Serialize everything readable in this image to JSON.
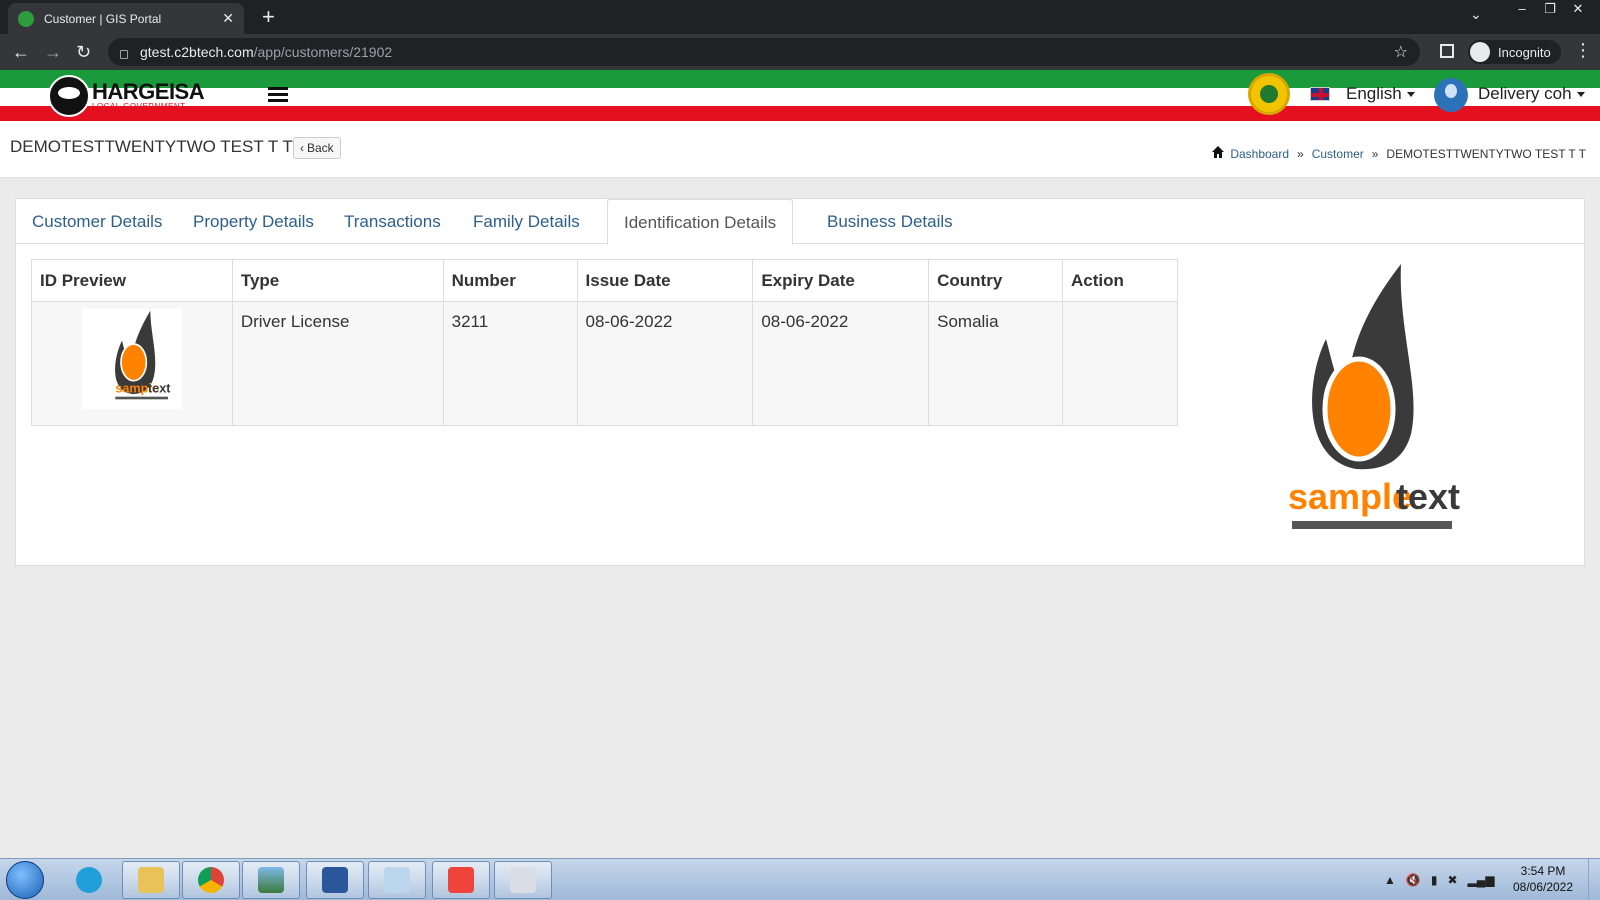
{
  "browser": {
    "tab_title": "Customer | GIS Portal",
    "tab_close": "✕",
    "new_tab": "+",
    "url_host": "gtest.c2btech.com",
    "url_path": "/app/customers/21902",
    "incognito_label": "Incognito"
  },
  "header": {
    "logo_name": "HARGEISA",
    "logo_sub": "LOCAL GOVERNMENT",
    "language": "English",
    "user_name": "Delivery coh"
  },
  "page": {
    "title": "DEMOTESTTWENTYTWO TEST T T",
    "back_label": "Back",
    "breadcrumb": [
      "Dashboard",
      "Customer",
      "DEMOTESTTWENTYTWO TEST T T"
    ],
    "breadcrumb_sep": "»"
  },
  "tabs": [
    {
      "label": "Customer Details",
      "active": false
    },
    {
      "label": "Property Details",
      "active": false
    },
    {
      "label": "Transactions",
      "active": false
    },
    {
      "label": "Family Details",
      "active": false
    },
    {
      "label": "Identification Details",
      "active": true
    },
    {
      "label": "Business Details",
      "active": false
    }
  ],
  "id_table": {
    "columns": [
      "ID Preview",
      "Type",
      "Number",
      "Issue Date",
      "Expiry Date",
      "Country",
      "Action"
    ],
    "rows": [
      {
        "type": "Driver License",
        "number": "3211",
        "issue_date": "08-06-2022",
        "expiry_date": "08-06-2022",
        "country": "Somalia",
        "action": ""
      }
    ]
  },
  "preview_image": {
    "caption_left": "sample",
    "caption_right": "text",
    "colors": {
      "flame": "#3a3a3a",
      "core": "#ff8200",
      "text_left": "#ff8200",
      "text_right": "#3a3a3a"
    }
  },
  "taskbar": {
    "time": "3:54 PM",
    "date": "08/06/2022"
  },
  "colors": {
    "flag_green": "#1a9a3a",
    "flag_red": "#e5101f",
    "link": "#2d5f8b"
  }
}
